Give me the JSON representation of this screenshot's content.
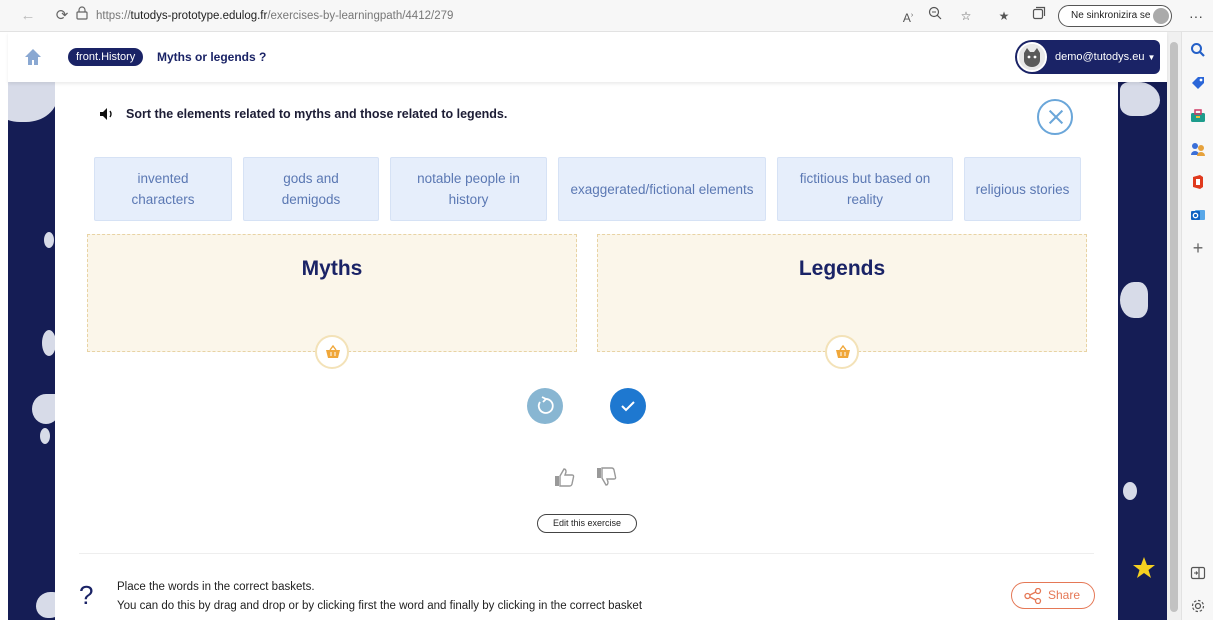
{
  "browser": {
    "url_prefix": "https://",
    "url_host": "tutodys-prototype.edulog.fr",
    "url_path": "/exercises-by-learningpath/4412/279",
    "sync_label": "Ne sinkronizira se",
    "more_label": "···",
    "nav_icons": [
      "back-arrow-icon",
      "refresh-icon"
    ],
    "right_icons": [
      "read-aloud-icon",
      "zoom-icon",
      "favorite-icon",
      "favorites-list-icon",
      "collections-icon"
    ]
  },
  "sidebar": {
    "icons": [
      "search-icon",
      "tag-icon",
      "toolbox-icon",
      "people-icon",
      "office-icon",
      "outlook-icon",
      "plus-icon",
      "split-screen-icon",
      "settings-icon"
    ],
    "plus_label": "+"
  },
  "header": {
    "breadcrumb": "front.History",
    "title": "Myths or legends ?",
    "user_email": "demo@tutodys.eu"
  },
  "exercise": {
    "instruction": "Sort the elements related to myths and those related to legends.",
    "chips": [
      "invented characters",
      "gods and demigods",
      "notable people in history",
      "exaggerated/fictional elements",
      "fictitious but based on reality",
      "religious stories"
    ],
    "baskets": [
      {
        "title": "Myths"
      },
      {
        "title": "Legends"
      }
    ],
    "edit_label": "Edit this exercise",
    "help_icon": "?",
    "help_line1": "Place the words in the correct baskets.",
    "help_line2": "You can do this by drag and drop or by clicking first the word and finally by clicking in the correct basket",
    "share_label": "Share"
  },
  "colors": {
    "navy": "#1a2366",
    "chip_bg": "#e6eefb",
    "chip_text": "#5b78b3",
    "basket_bg": "#fbf6ea",
    "check_blue": "#1e78d0",
    "reset_blue": "#88b6d2",
    "share_orange": "#e57856"
  }
}
